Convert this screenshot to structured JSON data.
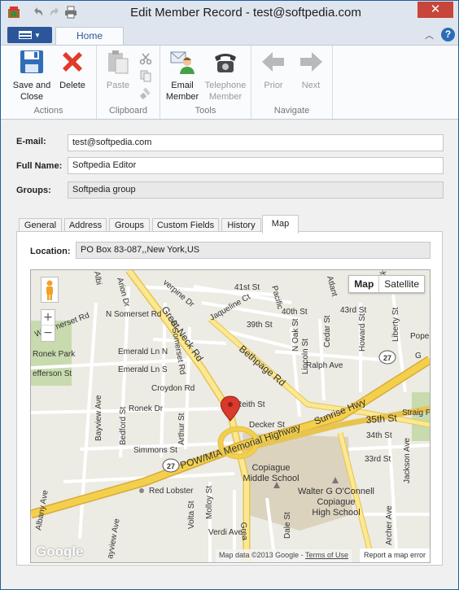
{
  "window": {
    "title": "Edit Member Record - test@softpedia.com",
    "close_glyph": "✕"
  },
  "ribbon": {
    "home_tab": "Home",
    "help": "?",
    "groups": {
      "actions": {
        "label": "Actions",
        "save_close": [
          "Save and",
          "Close"
        ],
        "delete": "Delete"
      },
      "clipboard": {
        "label": "Clipboard",
        "paste": "Paste"
      },
      "tools": {
        "label": "Tools",
        "email_member": [
          "Email",
          "Member"
        ],
        "telephone_member": [
          "Telephone",
          "Member"
        ]
      },
      "navigate": {
        "label": "Navigate",
        "prior": "Prior",
        "next": "Next"
      }
    }
  },
  "form": {
    "email_label": "E-mail:",
    "email_value": "test@softpedia.com",
    "fullname_label": "Full Name:",
    "fullname_value": "Softpedia Editor",
    "groups_label": "Groups:",
    "groups_value": "Softpedia group"
  },
  "tabs": [
    "General",
    "Address",
    "Groups",
    "Custom Fields",
    "History",
    "Map"
  ],
  "active_tab": "Map",
  "map_tab": {
    "location_label": "Location:",
    "location_value": "PO Box 83-087,,New York,US",
    "map_type": {
      "map": "Map",
      "satellite": "Satellite"
    },
    "zoom_in": "+",
    "zoom_out": "−",
    "attribution": "Map data ©2013 Google - ",
    "terms": "Terms of Use",
    "report": "Report a map error",
    "logo": "Google",
    "labels": {
      "great_neck_rd": "Great Neck Rd",
      "bethpage_rd": "Bethpage Rd",
      "sunrise_hwy": "Sunrise Hwy",
      "memorial_hwy": "POW/MIA Memorial Highway",
      "st_35th": "35th St",
      "st_34th": "34th St",
      "st_33rd": "33rd St",
      "st_41st": "41st St",
      "st_40th": "40th St",
      "st_39th": "39th St",
      "st_43rd": "43rd St",
      "emerald_ln_n": "Emerald Ln N",
      "emerald_ln_s": "Emerald Ln S",
      "croydon_rd": "Croydon Rd",
      "ronek_dr": "Ronek Dr",
      "ronek_park": "Ronek Park",
      "simmons_st": "Simmons St",
      "decker_st": "Decker St",
      "reith_st": "Reith St",
      "ralph_ave": "Ralph Ave",
      "jaqueline_ct": "Jaqueline Ct",
      "n_somerset_rd": "N Somerset Rd",
      "w_somerset_rd": "W Somerset Rd",
      "efferson_st": "efferson St",
      "red_lobster": "Red Lobster",
      "copiague_ms": [
        "Copiague",
        "Middle School"
      ],
      "copiague_hs": [
        "Walter G O'Connell",
        "Copiague",
        "High School"
      ],
      "route_27": "27",
      "bayview_ave": "Bayview Ave",
      "bedford_st": "Bedford St",
      "arthur_st": "Arthur St",
      "lincoln_st": "Lincoln St",
      "n_oak_st": "N Oak St",
      "cedar_st": "Cedar St",
      "howard_st": "Howard St",
      "liberty_st": "Liberty St",
      "jackson_ave": "Jackson Ave",
      "archer_ave": "Archer Ave",
      "verdi_ave": "Verdi Ave",
      "volta_st": "Volta St",
      "molloy_st": "Molloy St",
      "dale_st": "Dale St",
      "albany_ave": "Albany Ave",
      "verpine_dr": "verpine Dr",
      "arion_dr": "Arion Dr",
      "e_somerset_rd": "E Somerset Rd",
      "straight_path": "Straig Path R",
      "pope": "Pope",
      "pacific": "Pacific",
      "atlantic": "Atlant",
      "york": "York",
      "albi": "Albi",
      "great_short": "Grea",
      "bayview_short": "ayview Ave",
      "g_short": "G"
    }
  },
  "colors": {
    "accent": "#2b579a",
    "highway": "#f3d04b",
    "major_road": "#fbe893",
    "pin": "#d93a2b",
    "park": "#c8dbae",
    "school": "#dcd3bf"
  }
}
